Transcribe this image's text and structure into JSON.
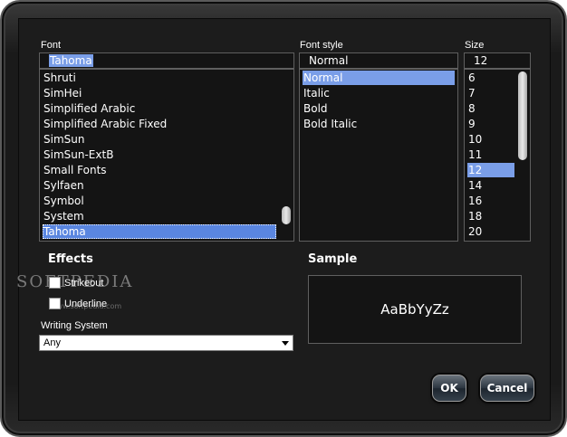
{
  "font": {
    "label": "Font",
    "value": "Tahoma",
    "items": [
      "Shruti",
      "SimHei",
      "Simplified Arabic",
      "Simplified Arabic Fixed",
      "SimSun",
      "SimSun-ExtB",
      "Small Fonts",
      "Sylfaen",
      "Symbol",
      "System",
      "Tahoma"
    ],
    "selected": "Tahoma"
  },
  "font_style": {
    "label": "Font style",
    "value": "Normal",
    "items": [
      "Normal",
      "Italic",
      "Bold",
      "Bold Italic"
    ],
    "selected": "Normal"
  },
  "size": {
    "label": "Size",
    "value": "12",
    "items": [
      "6",
      "7",
      "8",
      "9",
      "10",
      "11",
      "12",
      "14",
      "16",
      "18",
      "20"
    ],
    "selected": "12"
  },
  "effects": {
    "heading": "Effects",
    "strikeout_label": "Strikeout",
    "underline_label": "Underline"
  },
  "writing_system": {
    "label": "Writing System",
    "value": "Any"
  },
  "sample": {
    "heading": "Sample",
    "text": "AaBbYyZz"
  },
  "buttons": {
    "ok": "OK",
    "cancel": "Cancel"
  },
  "watermark": {
    "text": "SOFTPEDIA",
    "url": "www.softpedia.com"
  },
  "colors": {
    "selection": "#7a9ee8",
    "background": "#1c1c1c"
  }
}
